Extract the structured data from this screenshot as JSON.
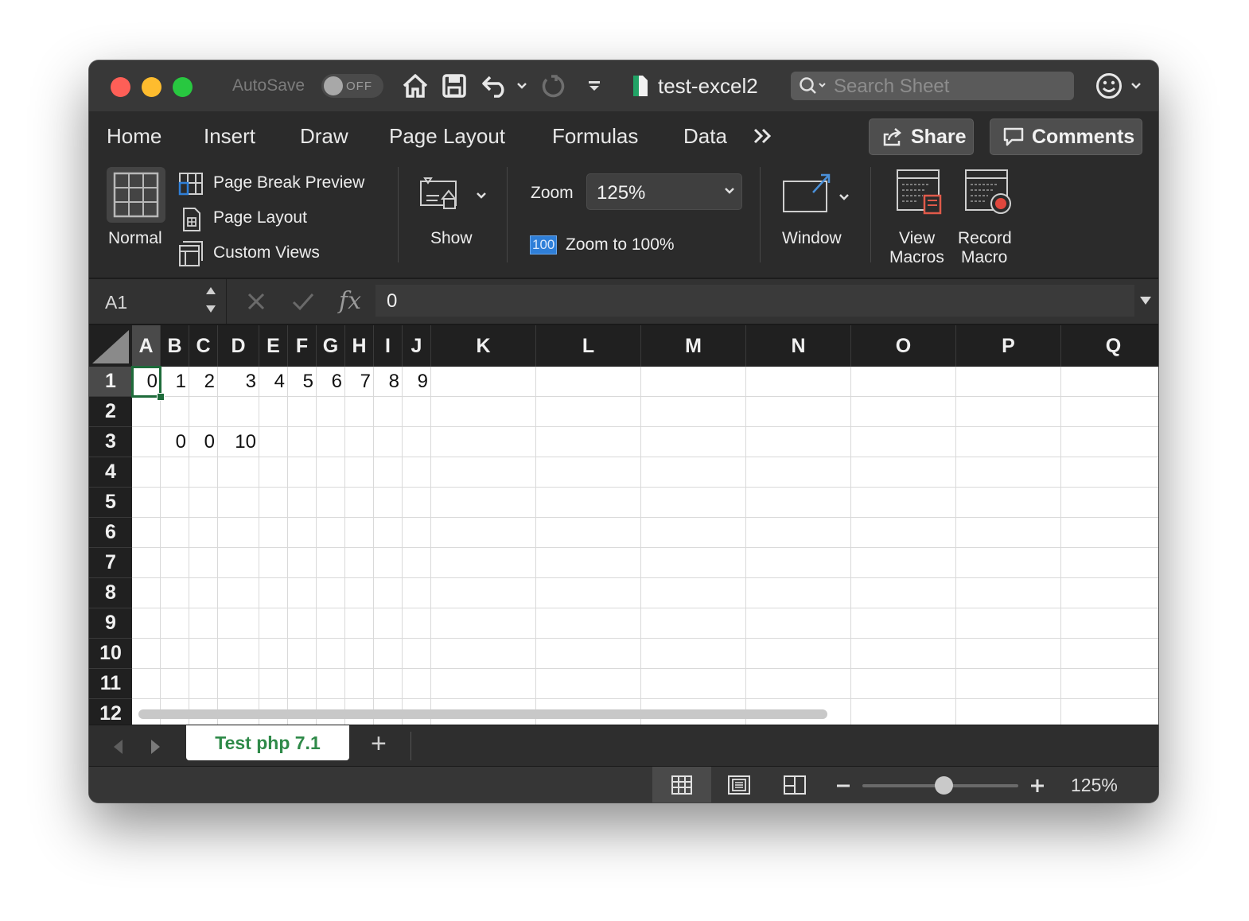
{
  "titlebar": {
    "autosave_label": "AutoSave",
    "autosave_state": "OFF",
    "document_title": "test-excel2",
    "search_placeholder": "Search Sheet"
  },
  "ribbon_tabs": [
    "Home",
    "Insert",
    "Draw",
    "Page Layout",
    "Formulas",
    "Data"
  ],
  "ribbon_actions": {
    "share_label": "Share",
    "comments_label": "Comments"
  },
  "ribbon": {
    "normal_label": "Normal",
    "page_break_preview_label": "Page Break Preview",
    "page_layout_label": "Page Layout",
    "custom_views_label": "Custom Views",
    "show_label": "Show",
    "zoom_label": "Zoom",
    "zoom_value": "125%",
    "zoom_100_badge": "100",
    "zoom_to_100_label": "Zoom to 100%",
    "window_label": "Window",
    "view_macros_line1": "View",
    "view_macros_line2": "Macros",
    "record_macro_line1": "Record",
    "record_macro_line2": "Macro"
  },
  "formula_bar": {
    "name_box": "A1",
    "fx_label": "fx",
    "value": "0"
  },
  "grid": {
    "columns": [
      "A",
      "B",
      "C",
      "D",
      "E",
      "F",
      "G",
      "H",
      "I",
      "J",
      "K",
      "L",
      "M",
      "N",
      "O",
      "P",
      "Q"
    ],
    "rows": [
      "1",
      "2",
      "3",
      "4",
      "5",
      "6",
      "7",
      "8",
      "9",
      "10",
      "11",
      "12"
    ],
    "selected_cell": "A1",
    "cells": {
      "A1": "0",
      "B1": "1",
      "C1": "2",
      "D1": "3",
      "E1": "4",
      "F1": "5",
      "G1": "6",
      "H1": "7",
      "I1": "8",
      "J1": "9",
      "B3": "0",
      "C3": "0",
      "D3": "10"
    }
  },
  "sheet_tabs": {
    "active": "Test php 7.1",
    "add_label": "+"
  },
  "status_bar": {
    "zoom_percent": "125%",
    "zoom_level_fraction": 0.52
  },
  "colors": {
    "close": "#fe5f57",
    "minimize": "#febc2e",
    "maximize": "#28c840",
    "sheet_tab_text": "#2f8a49",
    "selection_border": "#1e6b3a",
    "zoom_badge": "#2f7fd8"
  }
}
